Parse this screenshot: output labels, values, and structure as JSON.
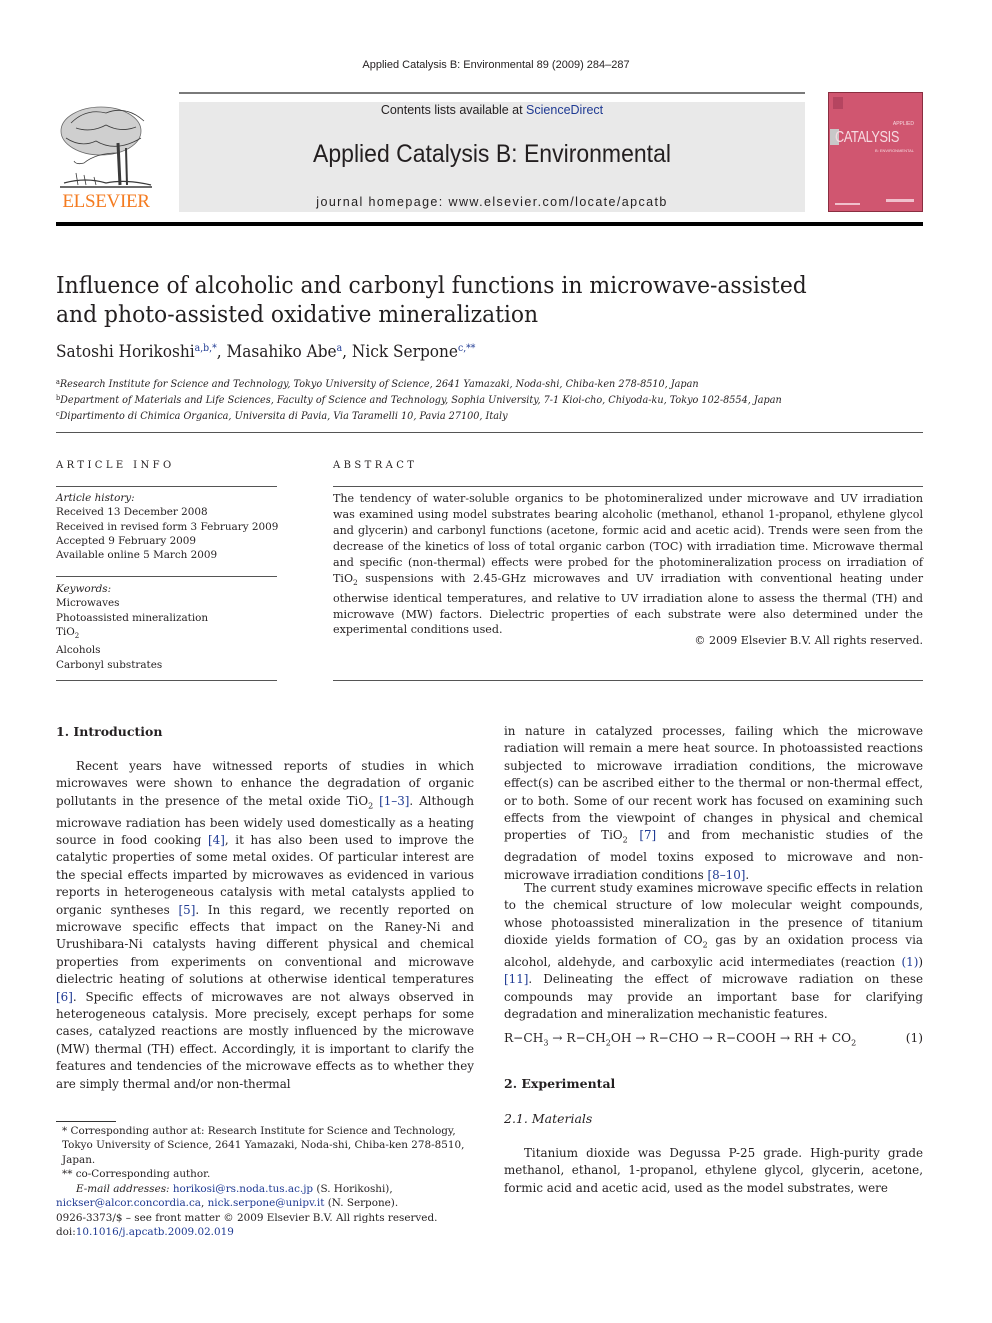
{
  "running_head": "Applied Catalysis B: Environmental 89 (2009) 284–287",
  "masthead": {
    "publisher_logo_text": "ELSEVIER",
    "contents_prefix": "Contents lists available at ",
    "contents_link": "ScienceDirect",
    "journal_name": "Applied Catalysis B: Environmental",
    "homepage_prefix": "journal homepage: ",
    "homepage_url": "www.elsevier.com/locate/apcatb",
    "cover_word": "CATALYSIS",
    "cover_top": "APPLIED",
    "cover_sub": "B: ENVIRONMENTAL",
    "colors": {
      "elsevier_orange": "#f47b20",
      "cover_pink": "#d05670",
      "band_gray": "#e9e9e9",
      "link_blue": "#1f3a93"
    }
  },
  "article": {
    "title_line1": "Influence of alcoholic and carbonyl functions in microwave-assisted",
    "title_line2": "and photo-assisted oxidative mineralization",
    "authors": [
      {
        "name": "Satoshi Horikoshi",
        "marks": "a,b,*",
        "sep": ", "
      },
      {
        "name": "Masahiko Abe",
        "marks": "a",
        "sep": ", "
      },
      {
        "name": "Nick Serpone",
        "marks": "c,**",
        "sep": ""
      }
    ],
    "affiliations": [
      {
        "mark": "a",
        "text": "Research Institute for Science and Technology, Tokyo University of Science, 2641 Yamazaki, Noda-shi, Chiba-ken 278-8510, Japan"
      },
      {
        "mark": "b",
        "text": "Department of Materials and Life Sciences, Faculty of Science and Technology, Sophia University, 7-1 Kioi-cho, Chiyoda-ku, Tokyo 102-8554, Japan"
      },
      {
        "mark": "c",
        "text": "Dipartimento di Chimica Organica, Universita di Pavia, Via Taramelli 10, Pavia 27100, Italy"
      }
    ]
  },
  "article_info": {
    "heading": "ARTICLE INFO",
    "history_label": "Article history:",
    "history": [
      "Received 13 December 2008",
      "Received in revised form 3 February 2009",
      "Accepted 9 February 2009",
      "Available online 5 March 2009"
    ],
    "keywords_label": "Keywords:",
    "keywords": [
      "Microwaves",
      "Photoassisted mineralization",
      "TiO",
      "Alcohols",
      "Carbonyl substrates"
    ],
    "keyword_tio2_sub": "2"
  },
  "abstract": {
    "heading": "ABSTRACT",
    "part1": "The tendency of water-soluble organics to be photomineralized under microwave and UV irradiation was examined using model substrates bearing alcoholic (methanol, ethanol 1-propanol, ethylene glycol and glycerin) and carbonyl functions (acetone, formic acid and acetic acid). Trends were seen from the decrease of the kinetics of loss of total organic carbon (TOC) with irradiation time. Microwave thermal and specific (non-thermal) effects were probed for the photomineralization process on irradiation of TiO",
    "sub": "2",
    "part2": " suspensions with 2.45-GHz microwaves and UV irradiation with conventional heating under otherwise identical temperatures, and relative to UV irradiation alone to assess the thermal (TH) and microwave (MW) factors. Dielectric properties of each substrate were also determined under the experimental conditions used.",
    "copyright": "© 2009 Elsevier B.V. All rights reserved."
  },
  "body": {
    "intro_heading": "1.  Introduction",
    "intro": {
      "t1": "Recent years have witnessed reports of studies in which microwaves were shown to enhance the degradation of organic pollutants in the presence of the metal oxide TiO",
      "s1": "2",
      "r1": "[1–3]",
      "t2": ". Although microwave radiation has been widely used domestically as a heating source in food cooking ",
      "r2": "[4]",
      "t3": ", it has also been used to improve the catalytic properties of some metal oxides. Of particular interest are the special effects imparted by microwaves as evidenced in various reports in heterogeneous catalysis with metal catalysts applied to organic syntheses ",
      "r3": "[5]",
      "t4": ". In this regard, we recently reported on microwave specific effects that impact on the Raney-Ni and Urushibara-Ni catalysts having different physical and chemical properties from experiments on conventional and microwave dielectric heating of solutions at otherwise identical temperatures ",
      "r4": "[6]",
      "t5": ". Specific effects of microwaves are not always observed in heterogeneous catalysis. More precisely, except perhaps for some cases, catalyzed reactions are mostly influenced by the microwave (MW) thermal (TH) effect. Accordingly, it is important to clarify the features and tendencies of the microwave effects as to whether they are simply thermal and/or non-thermal"
    },
    "right_p1": {
      "t1": "in nature in catalyzed processes, failing which the microwave radiation will remain a mere heat source. In photoassisted reactions subjected to microwave irradiation conditions, the microwave effect(s) can be ascribed either to the thermal or non-thermal effect, or to both. Some of our recent work has focused on examining such effects from the viewpoint of changes in physical and chemical properties of TiO",
      "s1": "2",
      "r1": "[7]",
      "t2": " and from mechanistic studies of the degradation of model toxins exposed to microwave and non-microwave irradiation conditions ",
      "r2": "[8–10]",
      "t3": "."
    },
    "right_p2": {
      "t1": "The current study examines microwave specific effects in relation to the chemical structure of low molecular weight compounds, whose photoassisted mineralization in the presence of titanium dioxide yields formation of CO",
      "s1": "2",
      "t2": " gas by an oxidation process via alcohol, aldehyde, and carboxylic acid intermediates (reaction ",
      "r1": "(1)",
      "t3": ") ",
      "r2": "[11]",
      "t4": ". Delineating the effect of microwave radiation on these compounds may provide an important base for clarifying degradation and mineralization mechanistic features."
    },
    "equation": {
      "a": "R−CH",
      "a_sub": "3",
      "b": " → R−CH",
      "b_sub": "2",
      "c": "OH → R−CHO → R−COOH → RH + CO",
      "c_sub": "2",
      "number": "(1)"
    },
    "exp_heading": "2.  Experimental",
    "materials_heading": "2.1.  Materials",
    "materials_text": "Titanium dioxide was Degussa P-25 grade. High-purity grade methanol, ethanol, 1-propanol, ethylene glycol, glycerin, acetone, formic acid and acetic acid, used as the model substrates, were"
  },
  "footnotes": {
    "fn1": "* Corresponding author at: Research Institute for Science and Technology, Tokyo University of Science, 2641 Yamazaki, Noda-shi, Chiba-ken 278-8510, Japan.",
    "fn2": "** co-Corresponding author.",
    "email_label": "E-mail addresses: ",
    "email1": "horikosi@rs.noda.tus.ac.jp",
    "email1_who": " (S. Horikoshi),",
    "email2": "nickser@alcor.concordia.ca",
    "email_sep": ", ",
    "email3": "nick.serpone@unipv.it",
    "email3_who": " (N. Serpone).",
    "front_matter": "0926-3373/$ – see front matter © 2009 Elsevier B.V. All rights reserved.",
    "doi_label": "doi:",
    "doi": "10.1016/j.apcatb.2009.02.019"
  }
}
